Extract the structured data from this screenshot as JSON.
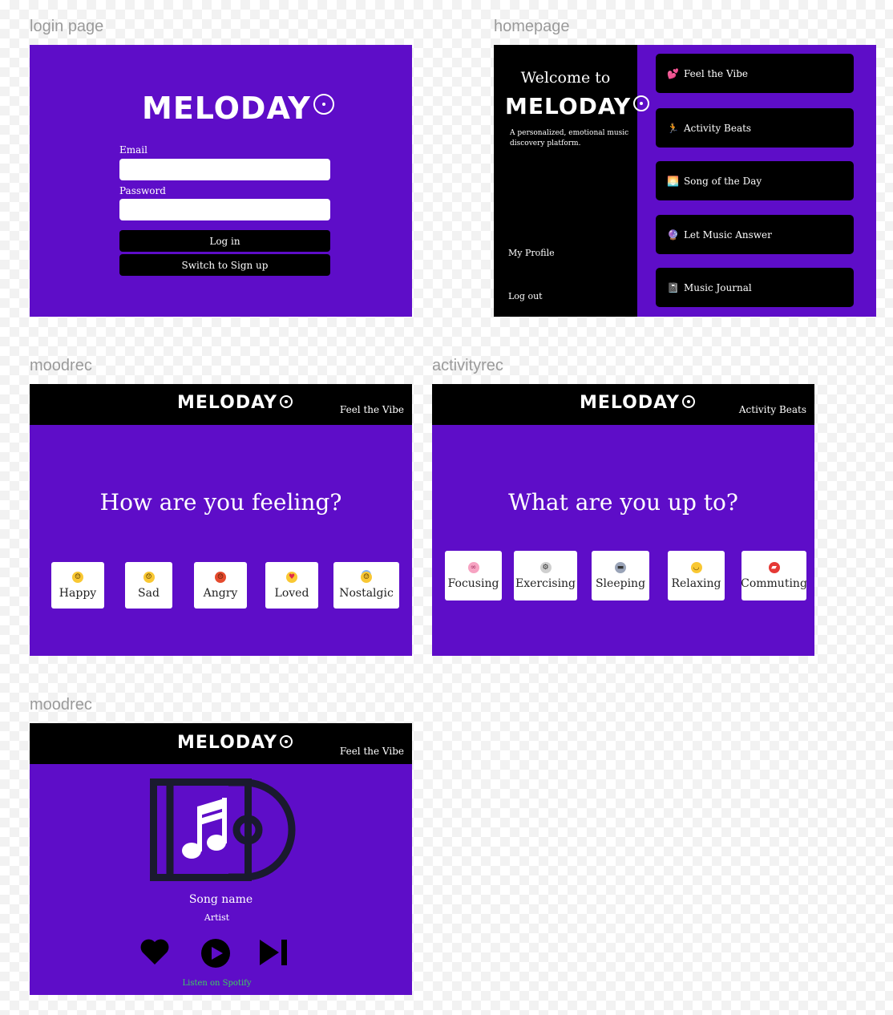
{
  "frames": {
    "login": {
      "label": "login page",
      "logo": "MELODAY",
      "email_label": "Email",
      "password_label": "Password",
      "email_value": "",
      "password_value": "",
      "login_button": "Log in",
      "signup_button": "Switch to Sign up"
    },
    "home": {
      "label": "homepage",
      "welcome": "Welcome to",
      "logo": "MELODAY",
      "tagline": "A personalized, emotional music discovery platform.",
      "my_profile": "My Profile",
      "log_out": "Log out",
      "menu": [
        {
          "emoji": "💕",
          "label": "Feel the Vibe"
        },
        {
          "emoji": "🏃",
          "label": "Activity Beats"
        },
        {
          "emoji": "🌅",
          "label": "Song of the Day"
        },
        {
          "emoji": "🔮",
          "label": "Let Music Answer"
        },
        {
          "emoji": "📓",
          "label": "Music Journal"
        }
      ]
    },
    "moodrec": {
      "label": "moodrec",
      "logo": "MELODAY",
      "section": "Feel the Vibe",
      "question": "How are you feeling?",
      "moods": [
        {
          "emoji": "😃",
          "label": "Happy"
        },
        {
          "emoji": "☹",
          "label": "Sad"
        },
        {
          "emoji": "😡",
          "label": "Angry"
        },
        {
          "emoji": "🥰",
          "label": "Loved"
        },
        {
          "emoji": "😇",
          "label": "Nostalgic"
        }
      ]
    },
    "activityrec": {
      "label": "activityrec",
      "logo": "MELODAY",
      "section": "Activity Beats",
      "question": "What are you up to?",
      "activities": [
        {
          "emoji": "🧠",
          "label": "Focusing"
        },
        {
          "emoji": "🚴",
          "label": "Exercising"
        },
        {
          "emoji": "🛏",
          "label": "Sleeping"
        },
        {
          "emoji": "😌",
          "label": "Relaxing"
        },
        {
          "emoji": "🚗",
          "label": "Commuting"
        }
      ]
    },
    "player": {
      "label": "moodrec",
      "logo": "MELODAY",
      "section": "Feel the Vibe",
      "song_name": "Song name",
      "artist": "Artist",
      "spotify_link": "Listen on Spotify"
    }
  },
  "colors": {
    "purple": "#5e0dc8",
    "black": "#000000",
    "spotify_green": "#3ecf5e"
  }
}
